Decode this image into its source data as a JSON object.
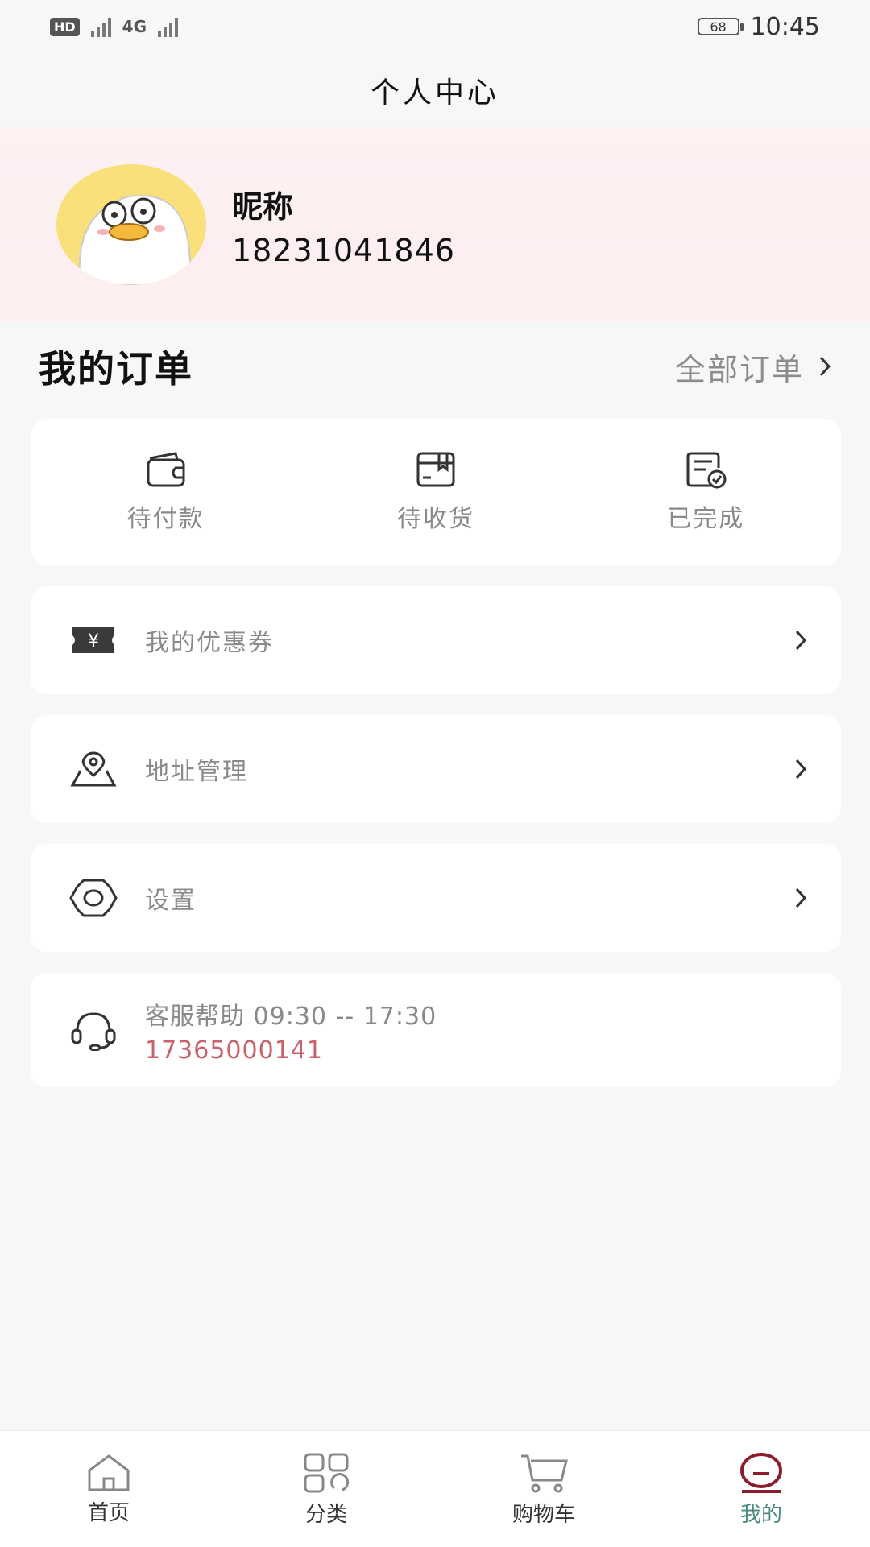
{
  "status_bar": {
    "network_badge": "HD",
    "network_type": "4G",
    "battery": "68",
    "time": "10:45"
  },
  "header": {
    "title": "个人中心"
  },
  "profile": {
    "nickname": "昵称",
    "phone": "18231041846"
  },
  "orders": {
    "title": "我的订单",
    "all_label": "全部订单",
    "items": [
      {
        "label": "待付款",
        "icon": "wallet-icon"
      },
      {
        "label": "待收货",
        "icon": "package-icon"
      },
      {
        "label": "已完成",
        "icon": "completed-doc-icon"
      }
    ]
  },
  "menu": [
    {
      "label": "我的优惠券",
      "icon": "coupon-icon"
    },
    {
      "label": "地址管理",
      "icon": "location-icon"
    },
    {
      "label": "设置",
      "icon": "gear-icon"
    }
  ],
  "help": {
    "title": "客服帮助 09:30 -- 17:30",
    "phone": "17365000141",
    "icon": "headset-icon"
  },
  "tabbar": {
    "items": [
      {
        "label": "首页",
        "icon": "home-icon"
      },
      {
        "label": "分类",
        "icon": "category-icon"
      },
      {
        "label": "购物车",
        "icon": "cart-icon"
      },
      {
        "label": "我的",
        "icon": "profile-icon"
      }
    ],
    "active_index": 3
  },
  "colors": {
    "accent_green": "#4a8a80",
    "accent_maroon": "#8b1e2d",
    "phone_red": "#c9616b",
    "profile_bg": "#fdeef0"
  }
}
